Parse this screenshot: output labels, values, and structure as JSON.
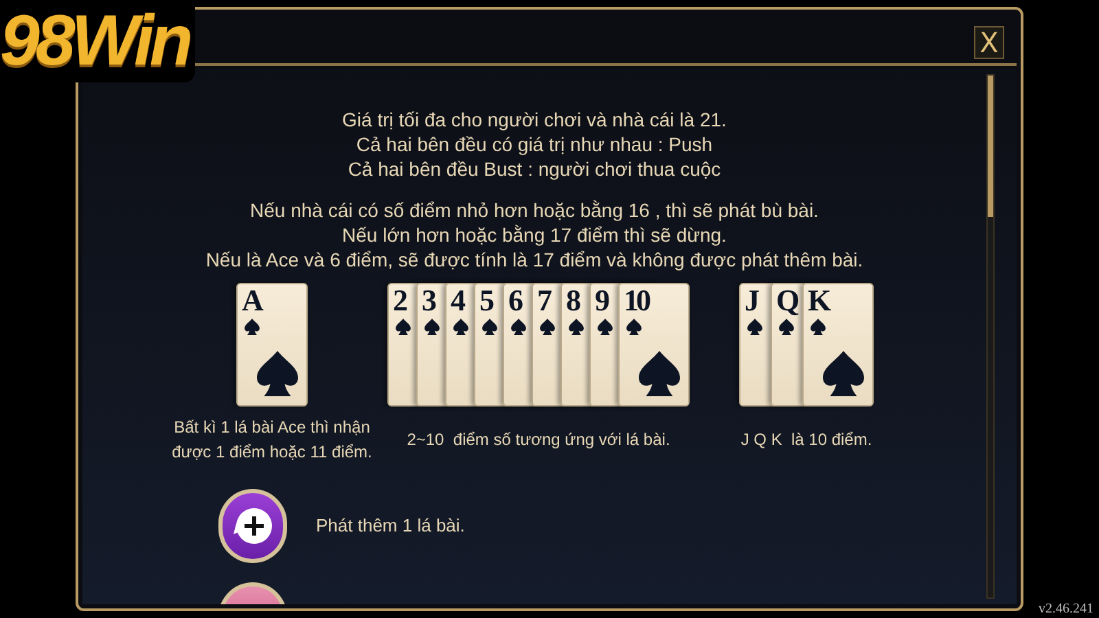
{
  "logo": "98Win",
  "close_button": "X",
  "rules": {
    "paragraphs": [
      [
        "Giá trị tối đa cho người chơi và nhà cái là 21.",
        "Cả hai bên đều có giá trị như nhau : Push",
        "Cả hai bên đều Bust : người chơi thua cuộc"
      ],
      [
        "Nếu nhà cái có số điểm nhỏ hơn hoặc bằng 16 , thì sẽ phát bù bài.",
        "Nếu lớn hơn hoặc bằng 17 điểm thì sẽ dừng.",
        "Nếu là Ace và 6 điểm, sẽ được tính là 17 điểm và không được phát thêm bài."
      ]
    ]
  },
  "card_groups": [
    {
      "ranks": [
        "A"
      ],
      "caption": "Bất kì 1 lá bài Ace thì nhận được 1 điểm hoặc 11 điểm."
    },
    {
      "ranks": [
        "2",
        "3",
        "4",
        "5",
        "6",
        "7",
        "8",
        "9",
        "10"
      ],
      "caption": "2~10  điểm số tương ứng với lá bài."
    },
    {
      "ranks": [
        "J",
        "Q",
        "K"
      ],
      "caption": "J Q K  là 10 điểm."
    }
  ],
  "actions": [
    {
      "kind": "hit",
      "label": "Phát thêm 1 lá bài."
    },
    {
      "kind": "cut-off"
    }
  ],
  "version": "v2.46.241"
}
